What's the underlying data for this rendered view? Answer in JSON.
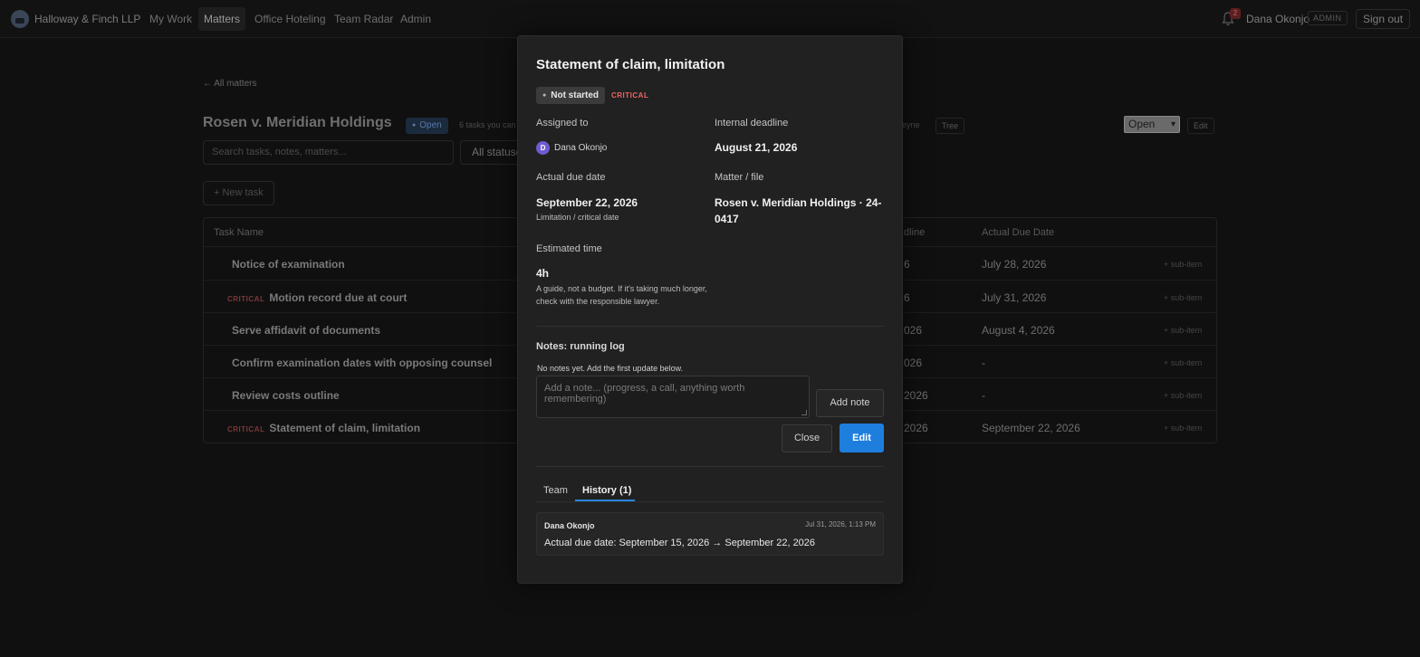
{
  "nav": {
    "firm": "Halloway & Finch LLP",
    "items": [
      "My Work",
      "Matters",
      "Office Hoteling",
      "Team Radar",
      "Admin"
    ],
    "active": "Matters",
    "notification_count": "2",
    "user_name": "Dana Okonjo",
    "role_badge": "ADMIN",
    "signout": "Sign out"
  },
  "matter": {
    "back_link": "← All matters",
    "title": "Rosen v. Meridian Holdings",
    "status_badge": "Open",
    "tasks_note": "6 tasks you can",
    "partial_text": "eyne",
    "tree_button": "Tree",
    "status_select": "Open",
    "edit_button": "Edit",
    "search_placeholder": "Search tasks, notes, matters...",
    "filter_label": "All statuses",
    "new_task": "+ New task"
  },
  "table": {
    "headers": {
      "name": "Task Name",
      "deadline": "dline",
      "due": "Actual Due Date"
    },
    "rows": [
      {
        "name": "Notice of examination",
        "critical": "",
        "deadline": "6",
        "due": "July 28, 2026",
        "sub": "+ sub-item"
      },
      {
        "name": "Motion record due at court",
        "critical": "CRITICAL",
        "deadline": "6",
        "due": "July 31, 2026",
        "sub": "+ sub-item"
      },
      {
        "name": "Serve affidavit of documents",
        "critical": "",
        "deadline": "026",
        "due": "August 4, 2026",
        "sub": "+ sub-item"
      },
      {
        "name": "Confirm examination dates with opposing counsel",
        "critical": "",
        "deadline": "026",
        "due": "-",
        "sub": "+ sub-item"
      },
      {
        "name": "Review costs outline",
        "critical": "",
        "deadline": "2026",
        "due": "-",
        "sub": "+ sub-item"
      },
      {
        "name": "Statement of claim, limitation",
        "critical": "CRITICAL",
        "deadline": "2026",
        "due": "September 22, 2026",
        "sub": "+ sub-item"
      }
    ]
  },
  "modal": {
    "title": "Statement of claim, limitation",
    "status": "Not started",
    "priority": "CRITICAL",
    "assigned_label": "Assigned to",
    "assignee_initial": "D",
    "assignee": "Dana Okonjo",
    "internal_deadline_label": "Internal deadline",
    "internal_deadline": "August 21, 2026",
    "actual_due_label": "Actual due date",
    "actual_due": "September 22, 2026",
    "actual_due_note": "Limitation / critical date",
    "matter_label": "Matter / file",
    "matter_value": "Rosen v. Meridian Holdings · 24-0417",
    "estimate_label": "Estimated time",
    "estimate": "4h",
    "estimate_note": "A guide, not a budget. If it's taking much longer, check with the responsible lawyer.",
    "notes_heading": "Notes: running log",
    "notes_empty": "No notes yet. Add the first update below.",
    "note_placeholder": "Add a note... (progress, a call, anything worth remembering)",
    "add_note": "Add note",
    "close": "Close",
    "edit": "Edit",
    "tabs": [
      "Team",
      "History (1)"
    ],
    "active_tab": "History (1)",
    "history": [
      {
        "author": "Dana Okonjo",
        "time": "Jul 31, 2026, 1:13 PM",
        "text": "Actual due date: September 15, 2026 → September 22, 2026"
      }
    ]
  }
}
